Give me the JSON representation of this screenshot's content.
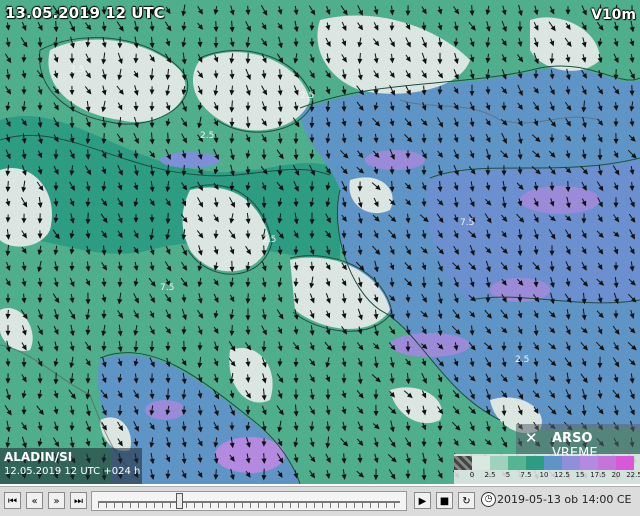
{
  "map": {
    "run_time": "13.05.2019 12 UTC",
    "variable": "V10m",
    "contour_labels": [
      "2.5",
      "2.5",
      "2.5",
      "2.5",
      "7.5",
      "2.5",
      "7.5"
    ]
  },
  "model": {
    "name": "ALADIN/SI",
    "run_info": "12.05.2019 12 UTC +024 h"
  },
  "logo": {
    "brand": "ARSO",
    "product": "VREME"
  },
  "legend": {
    "labels": [
      "0",
      "2.5",
      "5",
      "7.5",
      "10",
      "12.5",
      "15",
      "17.5",
      "20",
      "22.5"
    ],
    "colors": [
      "#333333",
      "#d9e8e0",
      "#9fd2bd",
      "#55b593",
      "#2c9c82",
      "#5f95c6",
      "#8f8fdc",
      "#b489e0",
      "#c276d9",
      "#d957d9"
    ]
  },
  "toolbar": {
    "first_label": "⏮",
    "prev_label": "«",
    "next_label": "»",
    "last_label": "⏭",
    "play_label": "▶",
    "stop_label": "■",
    "loop_label": "↻",
    "save_label": "⇩",
    "valid_time": "2019-05-13 ob 14:00 CE"
  },
  "icons": {
    "logo": "satellite-icon",
    "clock": "clock-icon"
  }
}
